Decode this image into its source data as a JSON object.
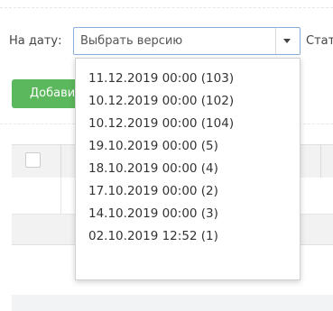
{
  "filter": {
    "date_label": "На дату:",
    "version_select": {
      "selected": "Выбрать версию"
    },
    "status_label": "Стат"
  },
  "toolbar": {
    "add_label": "Добавить"
  },
  "dropdown": {
    "options": [
      "11.12.2019 00:00 (103)",
      "10.12.2019 00:00 (102)",
      "10.12.2019 00:00 (104)",
      "19.10.2019 00:00 (5)",
      "18.10.2019 00:00 (4)",
      "17.10.2019 00:00 (2)",
      "14.10.2019 00:00 (3)",
      "02.10.2019 12:52 (1)"
    ]
  },
  "colors": {
    "accent_green": "#5cb85c",
    "select_border": "#8aaedc"
  },
  "icons": {
    "select_arrow": "caret-down-icon"
  }
}
